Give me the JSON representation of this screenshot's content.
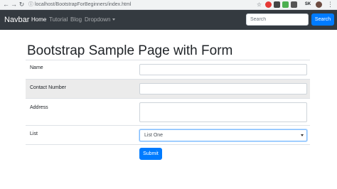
{
  "browser": {
    "url": "localhost/BootstrapForBeginners/index.html",
    "extensions": [
      "SK"
    ]
  },
  "navbar": {
    "brand": "Navbar",
    "links": [
      {
        "label": "Home",
        "active": true
      },
      {
        "label": "Tutorial",
        "active": false
      },
      {
        "label": "Blog",
        "active": false
      },
      {
        "label": "Dropdown",
        "active": false
      }
    ],
    "search_placeholder": "Search",
    "search_button": "Search"
  },
  "page": {
    "title": "Bootstrap Sample Page with Form",
    "form": {
      "name_label": "Name",
      "contact_label": "Contact Number",
      "address_label": "Address",
      "list_label": "List",
      "list_selected": "List One",
      "submit_label": "Submit"
    }
  },
  "colors": {
    "navbar_bg": "#343a40",
    "primary": "#007bff",
    "shaded_row": "#ebebeb"
  }
}
